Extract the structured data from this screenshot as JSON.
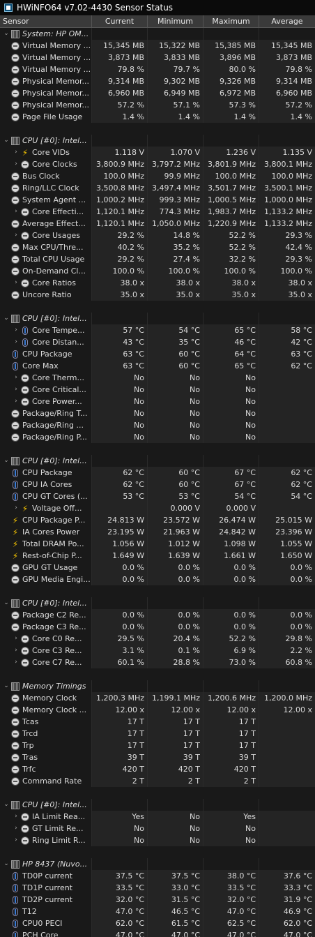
{
  "window": {
    "title": "HWiNFO64 v7.02-4430 Sensor Status"
  },
  "columns": [
    "Sensor",
    "Current",
    "Minimum",
    "Maximum",
    "Average"
  ],
  "rows": [
    {
      "type": "group",
      "label": "System: HP OM..."
    },
    {
      "type": "data",
      "icon": "circle",
      "label": "Virtual Memory ...",
      "cur": "15,345 MB",
      "min": "15,322 MB",
      "max": "15,385 MB",
      "avg": "15,345 MB"
    },
    {
      "type": "data",
      "icon": "circle",
      "label": "Virtual Memory ...",
      "cur": "3,873 MB",
      "min": "3,833 MB",
      "max": "3,896 MB",
      "avg": "3,873 MB"
    },
    {
      "type": "data",
      "icon": "circle",
      "label": "Virtual Memory ...",
      "cur": "79.8 %",
      "min": "79.7 %",
      "max": "80.0 %",
      "avg": "79.8 %"
    },
    {
      "type": "data",
      "icon": "circle",
      "label": "Physical Memor...",
      "cur": "9,314 MB",
      "min": "9,302 MB",
      "max": "9,326 MB",
      "avg": "9,314 MB"
    },
    {
      "type": "data",
      "icon": "circle",
      "label": "Physical Memor...",
      "cur": "6,960 MB",
      "min": "6,949 MB",
      "max": "6,972 MB",
      "avg": "6,960 MB"
    },
    {
      "type": "data",
      "icon": "circle",
      "label": "Physical Memor...",
      "cur": "57.2 %",
      "min": "57.1 %",
      "max": "57.3 %",
      "avg": "57.2 %"
    },
    {
      "type": "data",
      "icon": "circle",
      "label": "Page File Usage",
      "cur": "1.4 %",
      "min": "1.4 %",
      "max": "1.4 %",
      "avg": "1.4 %"
    },
    {
      "type": "blank"
    },
    {
      "type": "group",
      "label": "CPU [#0]: Intel..."
    },
    {
      "type": "data",
      "sub": true,
      "icon": "bolt",
      "label": "Core VIDs",
      "cur": "1.118 V",
      "min": "1.070 V",
      "max": "1.236 V",
      "avg": "1.135 V"
    },
    {
      "type": "data",
      "sub": true,
      "icon": "circle",
      "label": "Core Clocks",
      "cur": "3,800.9 MHz",
      "min": "3,797.2 MHz",
      "max": "3,801.9 MHz",
      "avg": "3,800.1 MHz"
    },
    {
      "type": "data",
      "icon": "circle",
      "label": "Bus Clock",
      "cur": "100.0 MHz",
      "min": "99.9 MHz",
      "max": "100.0 MHz",
      "avg": "100.0 MHz"
    },
    {
      "type": "data",
      "icon": "circle",
      "label": "Ring/LLC Clock",
      "cur": "3,500.8 MHz",
      "min": "3,497.4 MHz",
      "max": "3,501.7 MHz",
      "avg": "3,500.1 MHz"
    },
    {
      "type": "data",
      "icon": "circle",
      "label": "System Agent ...",
      "cur": "1,000.2 MHz",
      "min": "999.3 MHz",
      "max": "1,000.5 MHz",
      "avg": "1,000.0 MHz"
    },
    {
      "type": "data",
      "sub": true,
      "icon": "circle",
      "label": "Core Effecti...",
      "cur": "1,120.1 MHz",
      "min": "774.3 MHz",
      "max": "1,983.7 MHz",
      "avg": "1,133.2 MHz"
    },
    {
      "type": "data",
      "icon": "circle",
      "label": "Average Effect...",
      "cur": "1,120.1 MHz",
      "min": "1,050.0 MHz",
      "max": "1,220.9 MHz",
      "avg": "1,133.2 MHz"
    },
    {
      "type": "data",
      "sub": true,
      "icon": "circle",
      "label": "Core Usages",
      "cur": "29.2 %",
      "min": "14.8 %",
      "max": "52.2 %",
      "avg": "29.3 %"
    },
    {
      "type": "data",
      "icon": "circle",
      "label": "Max CPU/Thre...",
      "cur": "40.2 %",
      "min": "35.2 %",
      "max": "52.2 %",
      "avg": "42.4 %"
    },
    {
      "type": "data",
      "icon": "circle",
      "label": "Total CPU Usage",
      "cur": "29.2 %",
      "min": "27.4 %",
      "max": "32.2 %",
      "avg": "29.3 %"
    },
    {
      "type": "data",
      "icon": "circle",
      "label": "On-Demand Cl...",
      "cur": "100.0 %",
      "min": "100.0 %",
      "max": "100.0 %",
      "avg": "100.0 %"
    },
    {
      "type": "data",
      "sub": true,
      "icon": "circle",
      "label": "Core Ratios",
      "cur": "38.0 x",
      "min": "38.0 x",
      "max": "38.0 x",
      "avg": "38.0 x"
    },
    {
      "type": "data",
      "icon": "circle",
      "label": "Uncore Ratio",
      "cur": "35.0 x",
      "min": "35.0 x",
      "max": "35.0 x",
      "avg": "35.0 x"
    },
    {
      "type": "blank"
    },
    {
      "type": "group",
      "label": "CPU [#0]: Intel..."
    },
    {
      "type": "data",
      "sub": true,
      "icon": "therm",
      "label": "Core Tempe...",
      "cur": "57 °C",
      "min": "54 °C",
      "max": "65 °C",
      "avg": "58 °C"
    },
    {
      "type": "data",
      "sub": true,
      "icon": "therm",
      "label": "Core Distan...",
      "cur": "43 °C",
      "min": "35 °C",
      "max": "46 °C",
      "avg": "42 °C"
    },
    {
      "type": "data",
      "icon": "therm",
      "label": "CPU Package",
      "cur": "63 °C",
      "min": "60 °C",
      "max": "64 °C",
      "avg": "63 °C"
    },
    {
      "type": "data",
      "icon": "therm",
      "label": "Core Max",
      "cur": "63 °C",
      "min": "60 °C",
      "max": "65 °C",
      "avg": "62 °C"
    },
    {
      "type": "data",
      "sub": true,
      "icon": "circle",
      "label": "Core Therm...",
      "cur": "No",
      "min": "No",
      "max": "No",
      "avg": ""
    },
    {
      "type": "data",
      "sub": true,
      "icon": "circle",
      "label": "Core Critical...",
      "cur": "No",
      "min": "No",
      "max": "No",
      "avg": ""
    },
    {
      "type": "data",
      "sub": true,
      "icon": "circle",
      "label": "Core Power...",
      "cur": "No",
      "min": "No",
      "max": "No",
      "avg": ""
    },
    {
      "type": "data",
      "icon": "circle",
      "label": "Package/Ring T...",
      "cur": "No",
      "min": "No",
      "max": "No",
      "avg": ""
    },
    {
      "type": "data",
      "icon": "circle",
      "label": "Package/Ring ...",
      "cur": "No",
      "min": "No",
      "max": "No",
      "avg": ""
    },
    {
      "type": "data",
      "icon": "circle",
      "label": "Package/Ring P...",
      "cur": "No",
      "min": "No",
      "max": "No",
      "avg": ""
    },
    {
      "type": "blank"
    },
    {
      "type": "group",
      "label": "CPU [#0]: Intel..."
    },
    {
      "type": "data",
      "icon": "therm",
      "label": "CPU Package",
      "cur": "62 °C",
      "min": "60 °C",
      "max": "67 °C",
      "avg": "62 °C"
    },
    {
      "type": "data",
      "icon": "therm",
      "label": "CPU IA Cores",
      "cur": "62 °C",
      "min": "60 °C",
      "max": "67 °C",
      "avg": "62 °C"
    },
    {
      "type": "data",
      "icon": "therm",
      "label": "CPU GT Cores (...",
      "cur": "53 °C",
      "min": "53 °C",
      "max": "54 °C",
      "avg": "54 °C"
    },
    {
      "type": "data",
      "sub": true,
      "icon": "bolt",
      "label": "Voltage Off...",
      "cur": "",
      "min": "0.000 V",
      "max": "0.000 V",
      "avg": ""
    },
    {
      "type": "data",
      "icon": "bolt",
      "label": "CPU Package P...",
      "cur": "24.813 W",
      "min": "23.572 W",
      "max": "26.474 W",
      "avg": "25.015 W"
    },
    {
      "type": "data",
      "icon": "bolt",
      "label": "IA Cores Power",
      "cur": "23.195 W",
      "min": "21.963 W",
      "max": "24.842 W",
      "avg": "23.396 W"
    },
    {
      "type": "data",
      "icon": "bolt",
      "label": "Total DRAM Po...",
      "cur": "1.056 W",
      "min": "1.012 W",
      "max": "1.098 W",
      "avg": "1.055 W"
    },
    {
      "type": "data",
      "icon": "bolt",
      "label": "Rest-of-Chip P...",
      "cur": "1.649 W",
      "min": "1.639 W",
      "max": "1.661 W",
      "avg": "1.650 W"
    },
    {
      "type": "data",
      "icon": "circle",
      "label": "GPU GT Usage",
      "cur": "0.0 %",
      "min": "0.0 %",
      "max": "0.0 %",
      "avg": "0.0 %"
    },
    {
      "type": "data",
      "icon": "circle",
      "label": "GPU Media Engi...",
      "cur": "0.0 %",
      "min": "0.0 %",
      "max": "0.0 %",
      "avg": "0.0 %"
    },
    {
      "type": "blank"
    },
    {
      "type": "group",
      "label": "CPU [#0]: Intel..."
    },
    {
      "type": "data",
      "icon": "circle",
      "label": "Package C2 Re...",
      "cur": "0.0 %",
      "min": "0.0 %",
      "max": "0.0 %",
      "avg": "0.0 %"
    },
    {
      "type": "data",
      "icon": "circle",
      "label": "Package C3 Re...",
      "cur": "0.0 %",
      "min": "0.0 %",
      "max": "0.0 %",
      "avg": "0.0 %"
    },
    {
      "type": "data",
      "sub": true,
      "icon": "circle",
      "label": "Core C0 Re...",
      "cur": "29.5 %",
      "min": "20.4 %",
      "max": "52.2 %",
      "avg": "29.8 %"
    },
    {
      "type": "data",
      "sub": true,
      "icon": "circle",
      "label": "Core C3 Re...",
      "cur": "3.1 %",
      "min": "0.1 %",
      "max": "6.9 %",
      "avg": "2.2 %"
    },
    {
      "type": "data",
      "sub": true,
      "icon": "circle",
      "label": "Core C7 Re...",
      "cur": "60.1 %",
      "min": "28.8 %",
      "max": "73.0 %",
      "avg": "60.8 %"
    },
    {
      "type": "blank"
    },
    {
      "type": "group",
      "label": "Memory Timings"
    },
    {
      "type": "data",
      "icon": "circle",
      "label": "Memory Clock",
      "cur": "1,200.3 MHz",
      "min": "1,199.1 MHz",
      "max": "1,200.6 MHz",
      "avg": "1,200.0 MHz"
    },
    {
      "type": "data",
      "icon": "circle",
      "label": "Memory Clock ...",
      "cur": "12.00 x",
      "min": "12.00 x",
      "max": "12.00 x",
      "avg": "12.00 x"
    },
    {
      "type": "data",
      "icon": "circle",
      "label": "Tcas",
      "cur": "17 T",
      "min": "17 T",
      "max": "17 T",
      "avg": ""
    },
    {
      "type": "data",
      "icon": "circle",
      "label": "Trcd",
      "cur": "17 T",
      "min": "17 T",
      "max": "17 T",
      "avg": ""
    },
    {
      "type": "data",
      "icon": "circle",
      "label": "Trp",
      "cur": "17 T",
      "min": "17 T",
      "max": "17 T",
      "avg": ""
    },
    {
      "type": "data",
      "icon": "circle",
      "label": "Tras",
      "cur": "39 T",
      "min": "39 T",
      "max": "39 T",
      "avg": ""
    },
    {
      "type": "data",
      "icon": "circle",
      "label": "Trfc",
      "cur": "420 T",
      "min": "420 T",
      "max": "420 T",
      "avg": ""
    },
    {
      "type": "data",
      "icon": "circle",
      "label": "Command Rate",
      "cur": "2 T",
      "min": "2 T",
      "max": "2 T",
      "avg": ""
    },
    {
      "type": "blank"
    },
    {
      "type": "group",
      "label": "CPU [#0]: Intel..."
    },
    {
      "type": "data",
      "sub": true,
      "icon": "circle",
      "label": "IA Limit Rea...",
      "cur": "Yes",
      "min": "No",
      "max": "Yes",
      "avg": ""
    },
    {
      "type": "data",
      "sub": true,
      "icon": "circle",
      "label": "GT Limit Re...",
      "cur": "No",
      "min": "No",
      "max": "No",
      "avg": ""
    },
    {
      "type": "data",
      "sub": true,
      "icon": "circle",
      "label": "Ring Limit R...",
      "cur": "No",
      "min": "No",
      "max": "No",
      "avg": ""
    },
    {
      "type": "blank"
    },
    {
      "type": "group",
      "label": "HP 8437 (Nuvo..."
    },
    {
      "type": "data",
      "icon": "therm",
      "label": "TD0P current",
      "cur": "37.5 °C",
      "min": "37.5 °C",
      "max": "38.0 °C",
      "avg": "37.6 °C"
    },
    {
      "type": "data",
      "icon": "therm",
      "label": "TD1P current",
      "cur": "33.5 °C",
      "min": "33.0 °C",
      "max": "33.5 °C",
      "avg": "33.3 °C"
    },
    {
      "type": "data",
      "icon": "therm",
      "label": "TD2P current",
      "cur": "32.0 °C",
      "min": "31.5 °C",
      "max": "32.0 °C",
      "avg": "31.9 °C"
    },
    {
      "type": "data",
      "icon": "therm",
      "label": "T12",
      "cur": "47.0 °C",
      "min": "46.5 °C",
      "max": "47.0 °C",
      "avg": "46.9 °C"
    },
    {
      "type": "data",
      "icon": "therm",
      "label": "CPU0 PECI",
      "cur": "62.0 °C",
      "min": "61.5 °C",
      "max": "62.5 °C",
      "avg": "62.0 °C"
    },
    {
      "type": "data",
      "icon": "therm",
      "label": "PCH Core",
      "cur": "47.0 °C",
      "min": "47.0 °C",
      "max": "47.0 °C",
      "avg": "47.0 °C"
    }
  ]
}
